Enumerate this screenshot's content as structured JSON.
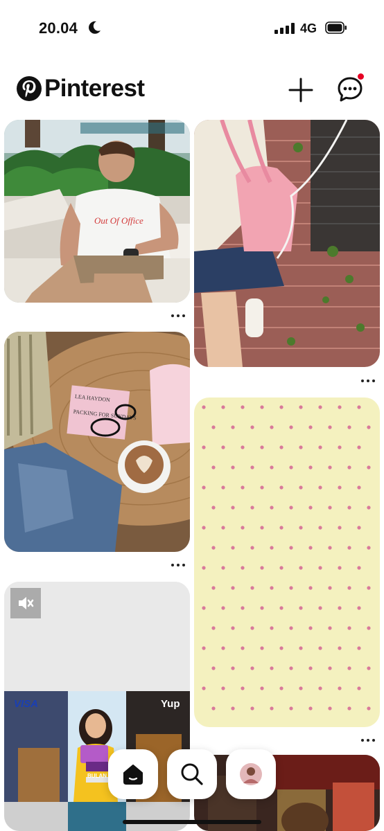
{
  "status_bar": {
    "time": "20.04",
    "network": "4G",
    "moon_icon": "moon-icon",
    "signal_icon": "signal-bars-icon",
    "battery_icon": "battery-icon"
  },
  "header": {
    "brand": "Pinterest",
    "create_icon": "plus-icon",
    "messages_icon": "chat-bubble-icon",
    "notification_color": "#e60023"
  },
  "pins": [
    {
      "name": "pin-man-out-of-office",
      "shirt_text": "Out Of Office"
    },
    {
      "name": "pin-pink-backpack"
    },
    {
      "name": "pin-book-coffee",
      "book_title": "PACKING FOR SUNDAYS",
      "book_author": "LEA HAYDON"
    },
    {
      "name": "pin-polka-dot-wallpaper",
      "background": "#f4f1bf",
      "dot_color": "#d97a9a"
    },
    {
      "name": "pin-ad-video",
      "muted_icon": "speaker-muted-icon",
      "brand_left": "VISA",
      "brand_right": "Yup",
      "caption": "BULAN"
    },
    {
      "name": "pin-night-market"
    }
  ],
  "nav": {
    "home_icon": "home-icon",
    "search_icon": "search-icon",
    "profile": "avatar"
  }
}
